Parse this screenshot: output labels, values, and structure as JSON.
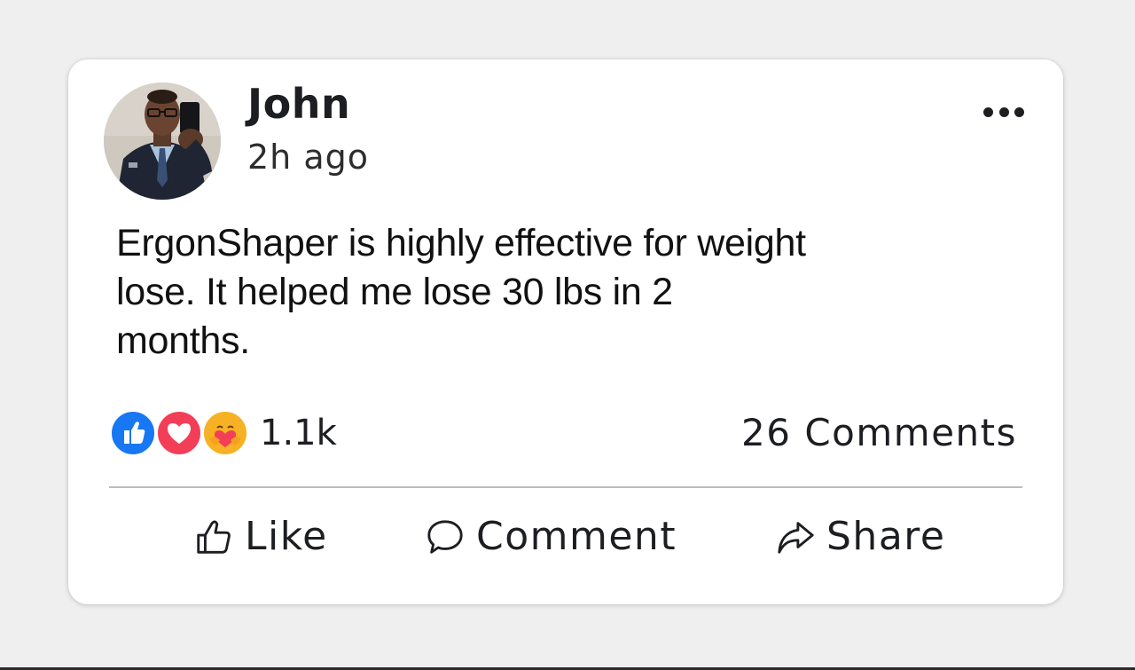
{
  "post": {
    "author": "John",
    "time": "2h ago",
    "text": "ErgonShaper is highly effective for weight\nlose. It helped me lose 30 lbs in 2\nmonths."
  },
  "stats": {
    "reaction_icons": [
      "like-icon",
      "love-icon",
      "care-icon"
    ],
    "reactions": "1.1k",
    "comments": "26 Comments"
  },
  "actions": {
    "like": "Like",
    "comment": "Comment",
    "share": "Share"
  },
  "colors": {
    "like_blue": "#1877f2",
    "love_red": "#f33e58",
    "care_yellow": "#f7b125"
  }
}
